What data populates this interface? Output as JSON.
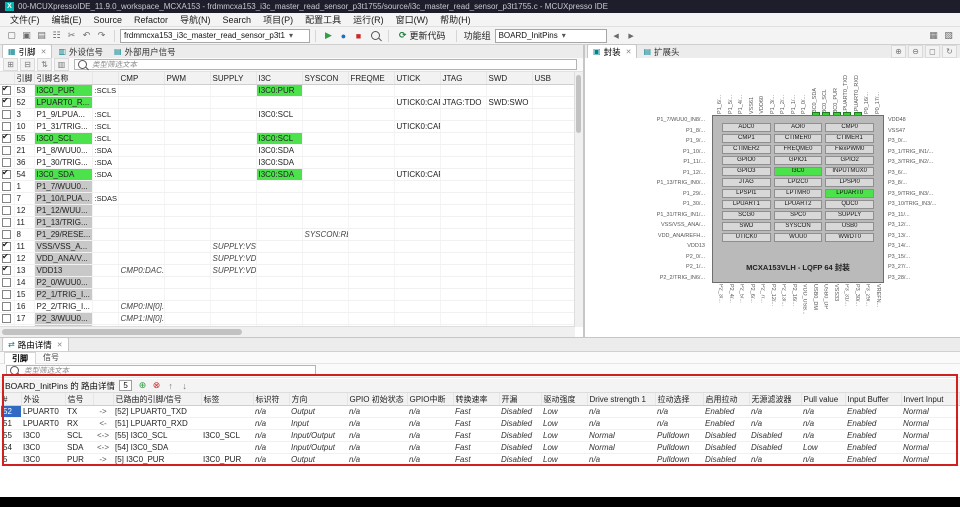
{
  "window": {
    "title": "00-MCUXpressoIDE_11.9.0_workspace_MCXA153 - frdmmcxa153_i3c_master_read_sensor_p3t1755/source/i3c_master_read_sensor_p3t1755.c - MCUXpresso IDE",
    "app_icon_glyph": "X"
  },
  "ui": {
    "close_glyph": "✕",
    "caret_glyph": "▾"
  },
  "colors": {
    "highlight_green": "#4ce24c",
    "row_gray": "#c8c8c8",
    "selection_blue": "#316ac5",
    "annotation_red": "#d21f1f"
  },
  "menu": {
    "items": [
      "文件(F)",
      "编辑(E)",
      "Source",
      "Refactor",
      "导航(N)",
      "Search",
      "项目(P)",
      "配置工具",
      "运行(R)",
      "窗口(W)",
      "帮助(H)"
    ]
  },
  "toolbar": {
    "left_icons": [
      {
        "name": "new-file-icon",
        "glyph": "▢"
      },
      {
        "name": "save-icon",
        "glyph": "▣"
      },
      {
        "name": "save-all-icon",
        "glyph": "▤"
      },
      {
        "name": "print-icon",
        "glyph": "☷"
      },
      {
        "name": "cut-icon",
        "glyph": "✂"
      },
      {
        "name": "undo-icon",
        "glyph": "↶"
      },
      {
        "name": "redo-icon",
        "glyph": "↷"
      }
    ],
    "project_combo": "frdmmcxa153_i3c_master_read_sensor_p3t1",
    "mid_icons": [
      {
        "name": "debug-icon",
        "glyph": "▶",
        "style": "color:#2f9e44"
      },
      {
        "name": "run-icon",
        "glyph": "●",
        "style": "color:#1971c2"
      },
      {
        "name": "stop-icon",
        "glyph": "■",
        "style": "color:#c92a2a"
      }
    ],
    "update_icon_glyph": "⟳",
    "update_code_label": "更新代码",
    "functional_group_label": "功能组",
    "group_combo": "BOARD_InitPins",
    "nav_icons": [
      {
        "name": "back-icon",
        "glyph": "◀"
      },
      {
        "name": "forward-icon",
        "glyph": "▶"
      }
    ],
    "right_icons": [
      {
        "name": "perspective-grid-icon",
        "glyph": "▦"
      },
      {
        "name": "pins-perspective-icon",
        "glyph": "▧"
      }
    ]
  },
  "pins_view": {
    "tabs": [
      {
        "label": "引脚",
        "icon": "▦"
      },
      {
        "label": "外设信号",
        "icon": "▥"
      },
      {
        "label": "外部用户信号",
        "icon": "▤"
      }
    ],
    "tools": [
      {
        "name": "expand-all-icon",
        "glyph": "⊞"
      },
      {
        "name": "collapse-all-icon",
        "glyph": "⊟"
      },
      {
        "name": "sort-icon",
        "glyph": "⇅"
      },
      {
        "name": "columns-icon",
        "glyph": "▥"
      }
    ],
    "filter_placeholder": "类型筛选文本",
    "columns": [
      "",
      "引脚",
      "引脚名称",
      "",
      "CMP",
      "PWM",
      "SUPPLY",
      "I3C",
      "SYSCON",
      "FREQME",
      "UTICK",
      "JTAG",
      "SWD",
      "USB"
    ],
    "rows": [
      {
        "checked": "true",
        "num": "53",
        "name": "I3C0_PUR",
        "suffix": ":SCLS",
        "hl": "green",
        "cells": [
          {},
          {},
          {},
          {
            "t": "I3C0:PUR",
            "c": "g"
          },
          {},
          {},
          {},
          {},
          {},
          {}
        ]
      },
      {
        "checked": "true",
        "num": "52",
        "name": "LPUART0_R...",
        "suffix": "",
        "hl": "green",
        "cells": [
          {},
          {},
          {},
          {},
          {},
          {},
          {
            "t": "UTICK0:CAP..."
          },
          {
            "t": "JTAG:TDO"
          },
          {
            "t": "SWD:SWO"
          },
          {}
        ]
      },
      {
        "num": "3",
        "name": "P1_9/LPUA...",
        "suffix": ":SCL",
        "cells": [
          {},
          {},
          {},
          {
            "t": "I3C0:SCL"
          },
          {},
          {},
          {},
          {},
          {},
          {}
        ]
      },
      {
        "num": "10",
        "name": "P1_31/TRIG...",
        "suffix": ":SCL",
        "cells": [
          {},
          {},
          {},
          {},
          {},
          {},
          {
            "t": "UTICK0:CAP..."
          },
          {},
          {},
          {}
        ]
      },
      {
        "checked": "true",
        "num": "55",
        "name": "I3C0_SCL",
        "suffix": ":SCL",
        "hl": "green",
        "cells": [
          {},
          {},
          {},
          {
            "t": "I3C0:SCL",
            "c": "g"
          },
          {},
          {},
          {},
          {},
          {},
          {}
        ]
      },
      {
        "num": "21",
        "name": "P1_8/WUU0...",
        "suffix": ":SDA",
        "cells": [
          {},
          {},
          {},
          {
            "t": "I3C0:SDA"
          },
          {},
          {},
          {},
          {},
          {},
          {}
        ]
      },
      {
        "num": "36",
        "name": "P1_30/TRIG...",
        "suffix": ":SDA",
        "cells": [
          {},
          {},
          {},
          {
            "t": "I3C0:SDA"
          },
          {},
          {},
          {},
          {},
          {},
          {}
        ]
      },
      {
        "checked": "true",
        "num": "54",
        "name": "I3C0_SDA",
        "suffix": ":SDA",
        "hl": "green",
        "cells": [
          {},
          {},
          {},
          {
            "t": "I3C0:SDA",
            "c": "g"
          },
          {},
          {},
          {
            "t": "UTICK0:CAP..."
          },
          {},
          {},
          {}
        ]
      },
      {
        "num": "1",
        "name": "P1_7/WUU0...",
        "hl": "gray",
        "cells": [
          {},
          {},
          {},
          {},
          {},
          {},
          {},
          {},
          {},
          {}
        ]
      },
      {
        "num": "7",
        "name": "P1_10/LPUA...",
        "suffix": ":SDAS",
        "hl": "gray",
        "cells": [
          {},
          {},
          {},
          {},
          {},
          {},
          {},
          {},
          {},
          {}
        ]
      },
      {
        "num": "12",
        "name": "P1_12/WUU...",
        "hl": "gray",
        "cells": [
          {},
          {},
          {},
          {},
          {},
          {},
          {},
          {},
          {},
          {}
        ]
      },
      {
        "num": "11",
        "name": "P1_13/TRIG...",
        "hl": "gray",
        "cells": [
          {},
          {},
          {},
          {},
          {},
          {},
          {},
          {},
          {},
          {}
        ]
      },
      {
        "num": "8",
        "name": "P1_29/RESE...",
        "hl": "gray",
        "cells": [
          {},
          {},
          {},
          {},
          {
            "t": "SYSCON:RE...",
            "c": "i"
          },
          {},
          {},
          {},
          {},
          {}
        ]
      },
      {
        "checked": "true",
        "num": "11",
        "name": "VSS/VSS_A...",
        "hl": "gray",
        "cells": [
          {},
          {},
          {
            "t": "SUPPLY:VSS...",
            "c": "i"
          },
          {},
          {},
          {},
          {},
          {},
          {},
          {}
        ]
      },
      {
        "checked": "true",
        "num": "12",
        "name": "VDD_ANA/V...",
        "hl": "gray",
        "cells": [
          {},
          {},
          {
            "t": "SUPPLY:VDD...",
            "c": "i"
          },
          {},
          {},
          {},
          {},
          {},
          {},
          {}
        ]
      },
      {
        "checked": "true",
        "num": "13",
        "name": "VDD13",
        "hl": "gray",
        "cells": [
          {
            "t": "CMP0:DAC...",
            "c": "i"
          },
          {},
          {
            "t": "SUPPLY:VDD",
            "c": "i"
          },
          {},
          {},
          {},
          {},
          {},
          {},
          {}
        ]
      },
      {
        "num": "14",
        "name": "P2_0/WUU0...",
        "hl": "gray",
        "cells": [
          {},
          {},
          {},
          {},
          {},
          {},
          {},
          {},
          {},
          {}
        ]
      },
      {
        "num": "15",
        "name": "P2_1/TRIG_I...",
        "hl": "gray",
        "cells": [
          {},
          {},
          {},
          {},
          {},
          {},
          {},
          {},
          {},
          {}
        ]
      },
      {
        "num": "16",
        "name": "P2_2/TRIG_I...",
        "cells": [
          {
            "t": "CMP0:IN[0]...",
            "c": "i"
          },
          {},
          {},
          {},
          {},
          {},
          {},
          {},
          {},
          {}
        ]
      },
      {
        "num": "17",
        "name": "P2_3/WUU0...",
        "hl": "gray",
        "cells": [
          {
            "t": "CMP1:IN[0]...",
            "c": "i"
          },
          {},
          {},
          {},
          {},
          {},
          {},
          {},
          {},
          {}
        ]
      },
      {
        "num": "18",
        "name": "P2_4/CT_IN...",
        "hl": "gray",
        "cells": [
          {},
          {},
          {},
          {},
          {},
          {},
          {},
          {},
          {},
          {}
        ]
      },
      {
        "num": "19",
        "name": "P2_5/CT_IN...",
        "hl": "gray",
        "cells": [
          {},
          {},
          {},
          {},
          {},
          {},
          {},
          {},
          {},
          {}
        ]
      }
    ]
  },
  "package_view": {
    "tabs": [
      {
        "label": "封装",
        "icon": "▣"
      },
      {
        "label": "扩展头",
        "icon": "▤"
      }
    ],
    "zoom_icons": [
      {
        "name": "zoom-in-icon",
        "glyph": "⊕"
      },
      {
        "name": "zoom-out-icon",
        "glyph": "⊖"
      },
      {
        "name": "zoom-fit-icon",
        "glyph": "◻"
      },
      {
        "name": "refresh-icon",
        "glyph": "↻"
      }
    ],
    "chip_title": "MCXA153VLH - LQFP 64 封装",
    "modules": [
      {
        "t": "ADC0"
      },
      {
        "t": "AOI0"
      },
      {
        "t": "CMP0"
      },
      {
        "t": "CMP1"
      },
      {
        "t": "CTIMER0"
      },
      {
        "t": "CTIMER1"
      },
      {
        "t": "CTIMER2"
      },
      {
        "t": "FREQME0"
      },
      {
        "t": "FlexPWM0"
      },
      {
        "t": "GPIO0"
      },
      {
        "t": "GPIO1"
      },
      {
        "t": "GPIO2"
      },
      {
        "t": "GPIO3"
      },
      {
        "t": "I3C0",
        "hl": "green"
      },
      {
        "t": "INPUTMUX0"
      },
      {
        "t": "JTAG"
      },
      {
        "t": "LPI2C0"
      },
      {
        "t": "LPSPI0"
      },
      {
        "t": "LPSPI1"
      },
      {
        "t": "LPTMR0"
      },
      {
        "t": "LPUART0",
        "hl": "green"
      },
      {
        "t": "LPUART1"
      },
      {
        "t": "LPUART2"
      },
      {
        "t": "QDC0"
      },
      {
        "t": "SCG0"
      },
      {
        "t": "SPC0"
      },
      {
        "t": "SUPPLY"
      },
      {
        "t": "SWD"
      },
      {
        "t": "SYSCON"
      },
      {
        "t": "USB0"
      },
      {
        "t": "UTICK0"
      },
      {
        "t": "WUU0"
      },
      {
        "t": "WWDT0"
      }
    ],
    "top_pins": [
      {
        "t": "P1_6/..."
      },
      {
        "t": "P1_5/..."
      },
      {
        "t": "P1_4/..."
      },
      {
        "t": "VSS61"
      },
      {
        "t": "VDD60"
      },
      {
        "t": "P1_3/..."
      },
      {
        "t": "P1_2/..."
      },
      {
        "t": "P1_1/..."
      },
      {
        "t": "P1_0/..."
      },
      {
        "t": "I3C0_SDA",
        "hl": "green"
      },
      {
        "t": "I3C0_SCL",
        "hl": "green"
      },
      {
        "t": "I3C0_PUR",
        "hl": "green"
      },
      {
        "t": "LPUART0_TXD",
        "hl": "green"
      },
      {
        "t": "LPUART0_RXD",
        "hl": "green"
      },
      {
        "t": "P0_16/..."
      },
      {
        "t": "P0_17/..."
      }
    ],
    "left_pins": [
      {
        "t": "P1_7/WUU0_IN8/..."
      },
      {
        "t": "P1_8/..."
      },
      {
        "t": "P1_9/..."
      },
      {
        "t": "P1_10/..."
      },
      {
        "t": "P1_11/..."
      },
      {
        "t": "P1_12/..."
      },
      {
        "t": "P1_13/TRIG_IN0/..."
      },
      {
        "t": "P1_29/..."
      },
      {
        "t": "P1_30/..."
      },
      {
        "t": "P1_31/TRIG_IN1/..."
      },
      {
        "t": "VSS/VSS_ANA/..."
      },
      {
        "t": "VDD_ANA/REFH..."
      },
      {
        "t": "VDD13"
      },
      {
        "t": "P2_0/..."
      },
      {
        "t": "P2_1/..."
      },
      {
        "t": "P2_2/TRIG_IN6/..."
      }
    ],
    "right_pins": [
      {
        "t": "VDD48"
      },
      {
        "t": "VSS47"
      },
      {
        "t": "P3_0/..."
      },
      {
        "t": "P3_1/TRIG_IN1/..."
      },
      {
        "t": "P3_3/TRIG_IN2/..."
      },
      {
        "t": "P3_6/..."
      },
      {
        "t": "P3_8/..."
      },
      {
        "t": "P3_9/TRIG_IN3/..."
      },
      {
        "t": "P3_10/TRIG_IN3/..."
      },
      {
        "t": "P3_11/..."
      },
      {
        "t": "P3_12/..."
      },
      {
        "t": "P3_13/..."
      },
      {
        "t": "P3_14/..."
      },
      {
        "t": "P3_15/..."
      },
      {
        "t": "P3_27/..."
      },
      {
        "t": "P3_28/..."
      }
    ],
    "bottom_pins": [
      {
        "t": "P2_3/..."
      },
      {
        "t": "P2_4/..."
      },
      {
        "t": "P2_5/..."
      },
      {
        "t": "P2_6/..."
      },
      {
        "t": "P2_7/..."
      },
      {
        "t": "P2_12/..."
      },
      {
        "t": "P2_13/..."
      },
      {
        "t": "P2_16/..."
      },
      {
        "t": "VDD_USB..."
      },
      {
        "t": "USB0_DM"
      },
      {
        "t": "USB0_DP"
      },
      {
        "t": "VSS33"
      },
      {
        "t": "P3_31/..."
      },
      {
        "t": "P3_30/..."
      },
      {
        "t": "P3_29/..."
      },
      {
        "t": "VREFN..."
      }
    ]
  },
  "routing_view": {
    "view_tab": "路由详情",
    "view_tab_icon": "⇄",
    "subtabs": [
      {
        "label": "引脚"
      },
      {
        "label": "信号"
      }
    ],
    "filter_placeholder": "类型筛选文本",
    "group_title": "BOARD_InitPins 的 路由详情",
    "count": "5",
    "action_icons": [
      {
        "name": "add-route-icon",
        "glyph": "⊕",
        "style": "color:#2f9e44"
      },
      {
        "name": "delete-route-icon",
        "glyph": "⊗",
        "style": "color:#c92a2a"
      },
      {
        "name": "move-up-icon",
        "glyph": "↑",
        "style": "color:#777777"
      },
      {
        "name": "move-down-icon",
        "glyph": "↓",
        "style": "color:#777777"
      }
    ],
    "columns": [
      "#",
      "外设",
      "信号",
      "",
      "已路由的引脚/信号",
      "标签",
      "标识符",
      "方向",
      "GPIO 初始状态",
      "GPIO中断",
      "转换速率",
      "开漏",
      "驱动强度",
      "Drive strength 1",
      "拉动选择",
      "启用拉动",
      "无源滤波器",
      "Pull value",
      "Input Buffer",
      "Invert Input"
    ],
    "rows": [
      {
        "sel": "true",
        "cells": [
          "52",
          "LPUART0",
          "TX",
          "->",
          "[52] LPUART0_TXD",
          "",
          "n/a",
          "Output",
          "n/a",
          "n/a",
          "Fast",
          "Disabled",
          "Low",
          "n/a",
          "n/a",
          "Enabled",
          "n/a",
          "n/a",
          "Enabled",
          "Normal"
        ]
      },
      {
        "cells": [
          "51",
          "LPUART0",
          "RX",
          "<-",
          "[51] LPUART0_RXD",
          "",
          "n/a",
          "Input",
          "n/a",
          "n/a",
          "Fast",
          "Disabled",
          "Low",
          "n/a",
          "n/a",
          "Enabled",
          "n/a",
          "n/a",
          "Enabled",
          "Normal"
        ]
      },
      {
        "cells": [
          "55",
          "I3C0",
          "SCL",
          "<->",
          "[55] I3C0_SCL",
          "I3C0_SCL",
          "n/a",
          "Input/Output",
          "n/a",
          "n/a",
          "Fast",
          "Disabled",
          "Low",
          "Normal",
          "Pulldown",
          "Disabled",
          "Disabled",
          "n/a",
          "Enabled",
          "Normal"
        ]
      },
      {
        "cells": [
          "54",
          "I3C0",
          "SDA",
          "<->",
          "[54] I3C0_SDA",
          "",
          "n/a",
          "Input/Output",
          "n/a",
          "n/a",
          "Fast",
          "Disabled",
          "Low",
          "Normal",
          "Pulldown",
          "Disabled",
          "Disabled",
          "Low",
          "Enabled",
          "Normal"
        ]
      },
      {
        "cells": [
          "5",
          "I3C0",
          "PUR",
          "->",
          "[5] I3C0_PUR",
          "I3C0_PUR",
          "n/a",
          "Output",
          "n/a",
          "n/a",
          "Fast",
          "Disabled",
          "Low",
          "n/a",
          "Pulldown",
          "Disabled",
          "n/a",
          "n/a",
          "Enabled",
          "Normal"
        ]
      }
    ]
  }
}
